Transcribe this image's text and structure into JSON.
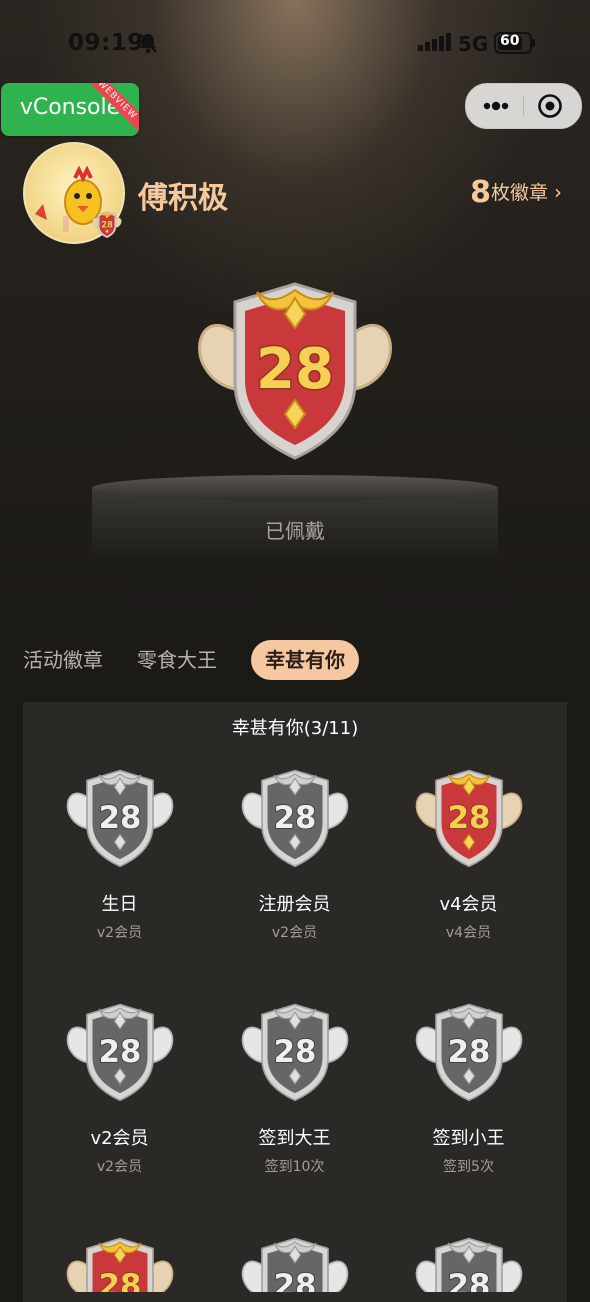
{
  "status_bar": {
    "time": "09:19",
    "network": "5G",
    "battery": "60"
  },
  "vconsole": {
    "label": "vConsole",
    "ribbon": "WEBVIEW"
  },
  "profile": {
    "name": "傅积极",
    "avatar_level": "28",
    "badge_count": "8",
    "badge_label": "枚徽章",
    "chevron": "›"
  },
  "hero": {
    "level": "28",
    "status": "已佩戴"
  },
  "tabs": [
    {
      "label": "活动徽章",
      "active": false
    },
    {
      "label": "零食大王",
      "active": false
    },
    {
      "label": "幸甚有你",
      "active": true
    }
  ],
  "section": {
    "title": "幸甚有你(3/11)",
    "badges": [
      {
        "name": "生日",
        "sub": "v2会员",
        "level": "28",
        "earned": false
      },
      {
        "name": "注册会员",
        "sub": "v2会员",
        "level": "28",
        "earned": false
      },
      {
        "name": "v4会员",
        "sub": "v4会员",
        "level": "28",
        "earned": true
      },
      {
        "name": "v2会员",
        "sub": "v2会员",
        "level": "28",
        "earned": false
      },
      {
        "name": "签到大王",
        "sub": "签到10次",
        "level": "28",
        "earned": false
      },
      {
        "name": "签到小王",
        "sub": "签到5次",
        "level": "28",
        "earned": false
      }
    ],
    "partial_row": [
      {
        "earned": true
      },
      {
        "earned": false
      },
      {
        "earned": false
      }
    ]
  },
  "colors": {
    "accent": "#f6c8a2",
    "gold_text": "#f5c99c",
    "vconsole_green": "#2fb34e",
    "ribbon_red": "#e8474f",
    "panel_bg": "#2b2925",
    "earned_red": "#c9383b",
    "locked_gray": "#6a6a6a"
  }
}
